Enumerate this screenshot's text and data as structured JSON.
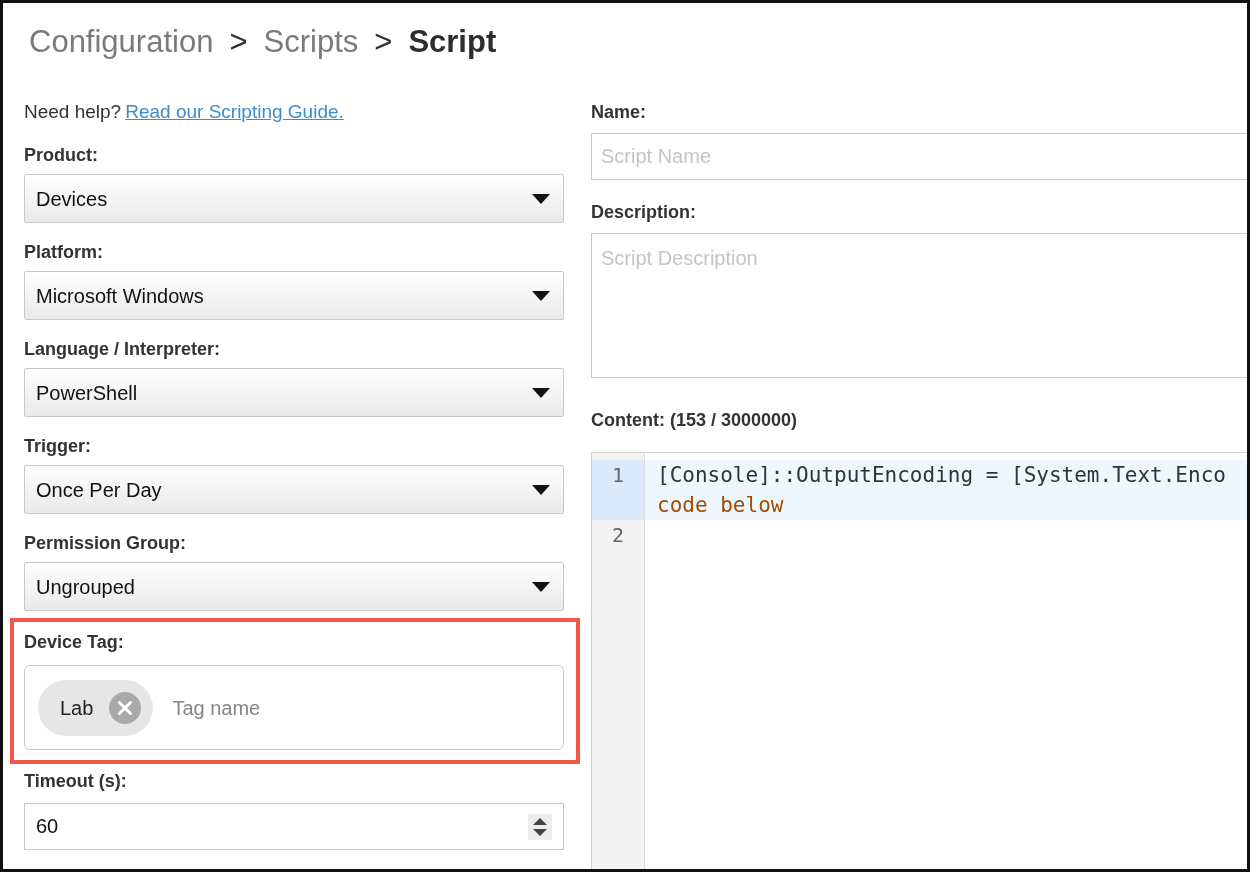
{
  "breadcrumb": [
    {
      "kind": "link",
      "label": "Configuration"
    },
    {
      "kind": "separator",
      "label": ">"
    },
    {
      "kind": "link",
      "label": "Scripts"
    },
    {
      "kind": "separator",
      "label": ">"
    },
    {
      "kind": "current",
      "label": "Script"
    }
  ],
  "help": {
    "text": "Need help?",
    "link": "Read our Scripting Guide."
  },
  "left_fields": [
    {
      "kind": "select",
      "label": "Product:",
      "value": "Devices"
    },
    {
      "kind": "select",
      "label": "Platform:",
      "value": "Microsoft Windows"
    },
    {
      "kind": "select",
      "label": "Language / Interpreter:",
      "value": "PowerShell"
    },
    {
      "kind": "select",
      "label": "Trigger:",
      "value": "Once Per Day"
    },
    {
      "kind": "select",
      "label": "Permission Group:",
      "value": "Ungrouped"
    },
    {
      "kind": "tags",
      "label": "Device Tag:",
      "highlighted": true,
      "tags": [
        {
          "label": "Lab"
        }
      ],
      "placeholder": "Tag name"
    },
    {
      "kind": "number",
      "label": "Timeout (s):",
      "value": "60"
    }
  ],
  "right_fields": [
    {
      "kind": "text",
      "label": "Name:",
      "placeholder": "Script Name"
    },
    {
      "kind": "textarea",
      "label": "Description:",
      "placeholder": "Script Description"
    },
    {
      "kind": "editor",
      "label": "Content: (153 / 3000000)",
      "lines": [
        {
          "number": "1",
          "active": true,
          "rows": [
            {
              "kind": "plain",
              "text": "[Console]::OutputEncoding = [System.Text.Enco"
            },
            {
              "kind": "comment",
              "text": "code below"
            }
          ]
        },
        {
          "number": "2",
          "active": false
        }
      ]
    }
  ]
}
